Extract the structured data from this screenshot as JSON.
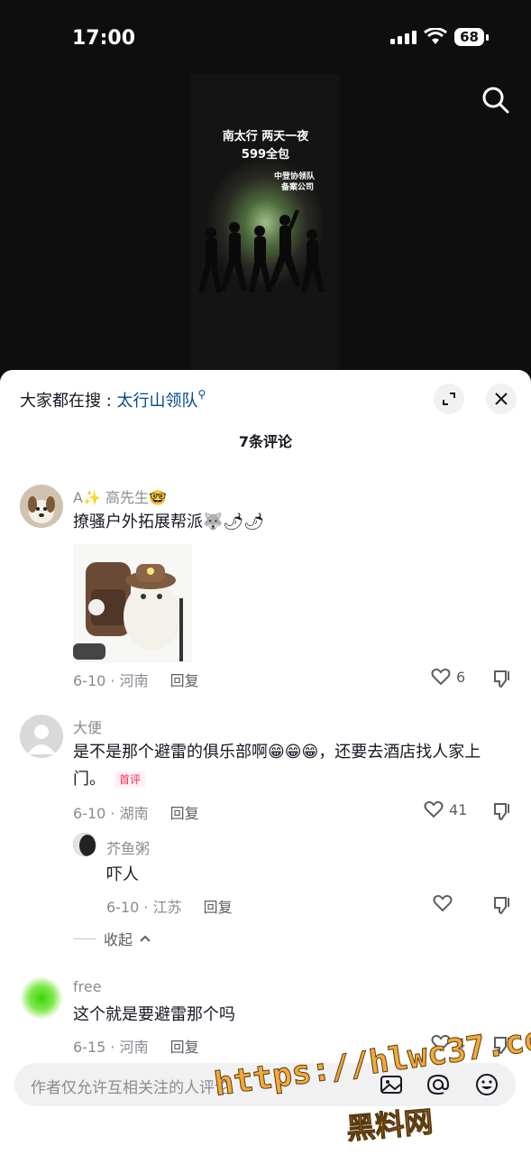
{
  "status_bar": {
    "time": "17:00",
    "battery": "68"
  },
  "video": {
    "title_line1": "南太行 两天一夜",
    "title_line2": "599全包",
    "sub_line1": "中登协领队",
    "sub_line2": "备案公司"
  },
  "sheet": {
    "trend_prefix": "大家都在搜 : ",
    "trend_keyword": "太行山领队",
    "comment_count": "7条评论"
  },
  "comments": [
    {
      "name": "A✨ 高先生🤓",
      "text": "撩骚户外拓展帮派🐺🌶🌶",
      "date_loc": "6-10 · 河南",
      "reply": "回复",
      "likes": "6"
    },
    {
      "name": "大便",
      "text": "是不是那个避雷的俱乐部啊😁😁😁，还要去酒店找人家上门。",
      "badge": "首评",
      "date_loc": "6-10 · 湖南",
      "reply": "回复",
      "likes": "41"
    },
    {
      "name": "芥鱼粥",
      "text": "吓人",
      "date_loc": "6-10 · 江苏",
      "reply": "回复",
      "likes": ""
    },
    {
      "name": "free",
      "text": "这个就是要避雷那个吗",
      "date_loc": "6-15 · 河南",
      "reply": "回复",
      "likes": "4"
    }
  ],
  "collapse_label": "收起",
  "input": {
    "placeholder": "作者仅允许互相关注的人评论"
  },
  "watermark": {
    "line1": "https://hlwc37.com",
    "line2": "黑料网"
  }
}
